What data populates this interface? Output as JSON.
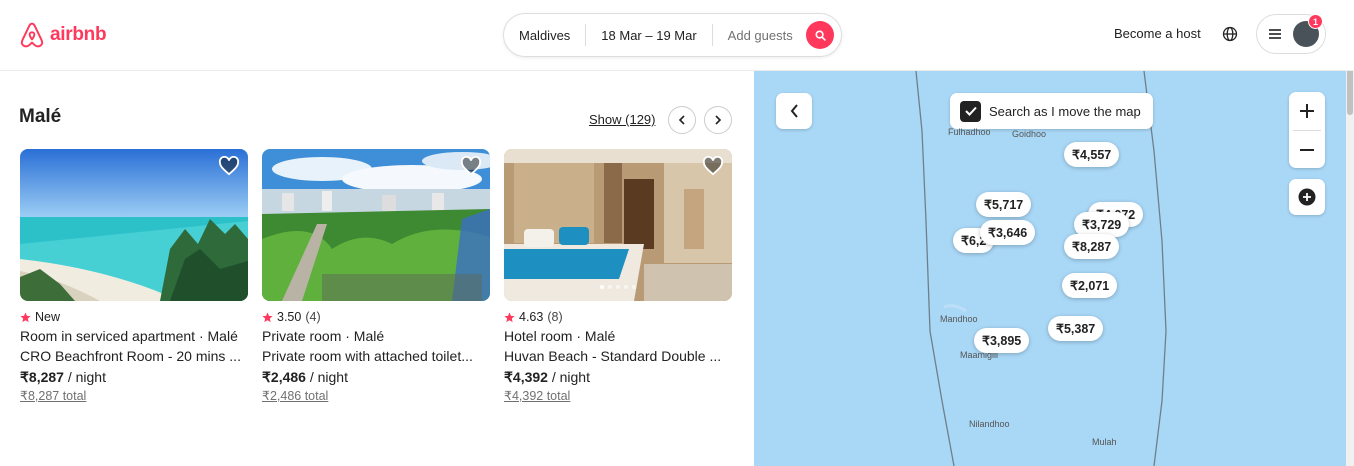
{
  "brand": {
    "name": "airbnb",
    "color": "#ff385c"
  },
  "search": {
    "location": "Maldives",
    "dates": "18 Mar – 19 Mar",
    "guests_placeholder": "Add guests"
  },
  "header": {
    "become_host": "Become a host",
    "notification_count": "1"
  },
  "list": {
    "title": "Malé",
    "show_label": "Show (129)",
    "cards": [
      {
        "rating": "New",
        "reviews": "",
        "type": "Room in serviced apartment · Malé",
        "name": "CRO Beachfront Room - 20 mins ...",
        "price": "₹8,287",
        "per": " / night",
        "total": "₹8,287 total"
      },
      {
        "rating": "3.50",
        "reviews": "(4)",
        "type": "Private room · Malé",
        "name": "Private room with attached toilet...",
        "price": "₹2,486",
        "per": " / night",
        "total": "₹2,486 total"
      },
      {
        "rating": "4.63",
        "reviews": "(8)",
        "type": "Hotel room · Malé",
        "name": "Huvan Beach - Standard Double ...",
        "price": "₹4,392",
        "per": " / night",
        "total": "₹4,392 total"
      }
    ]
  },
  "map": {
    "search_as_move": "Search as I move the map",
    "pins": [
      "₹4,557",
      "₹5,717",
      "₹4,072",
      "₹3,729",
      "₹6,2",
      "₹3,646",
      "₹8,287",
      "₹2,071",
      "₹5,387",
      "₹3,895"
    ],
    "places": [
      "Fulhadhoo",
      "Goidhoo",
      "Mandhoo",
      "Maamigili",
      "Nilandhoo",
      "Mulah"
    ]
  }
}
